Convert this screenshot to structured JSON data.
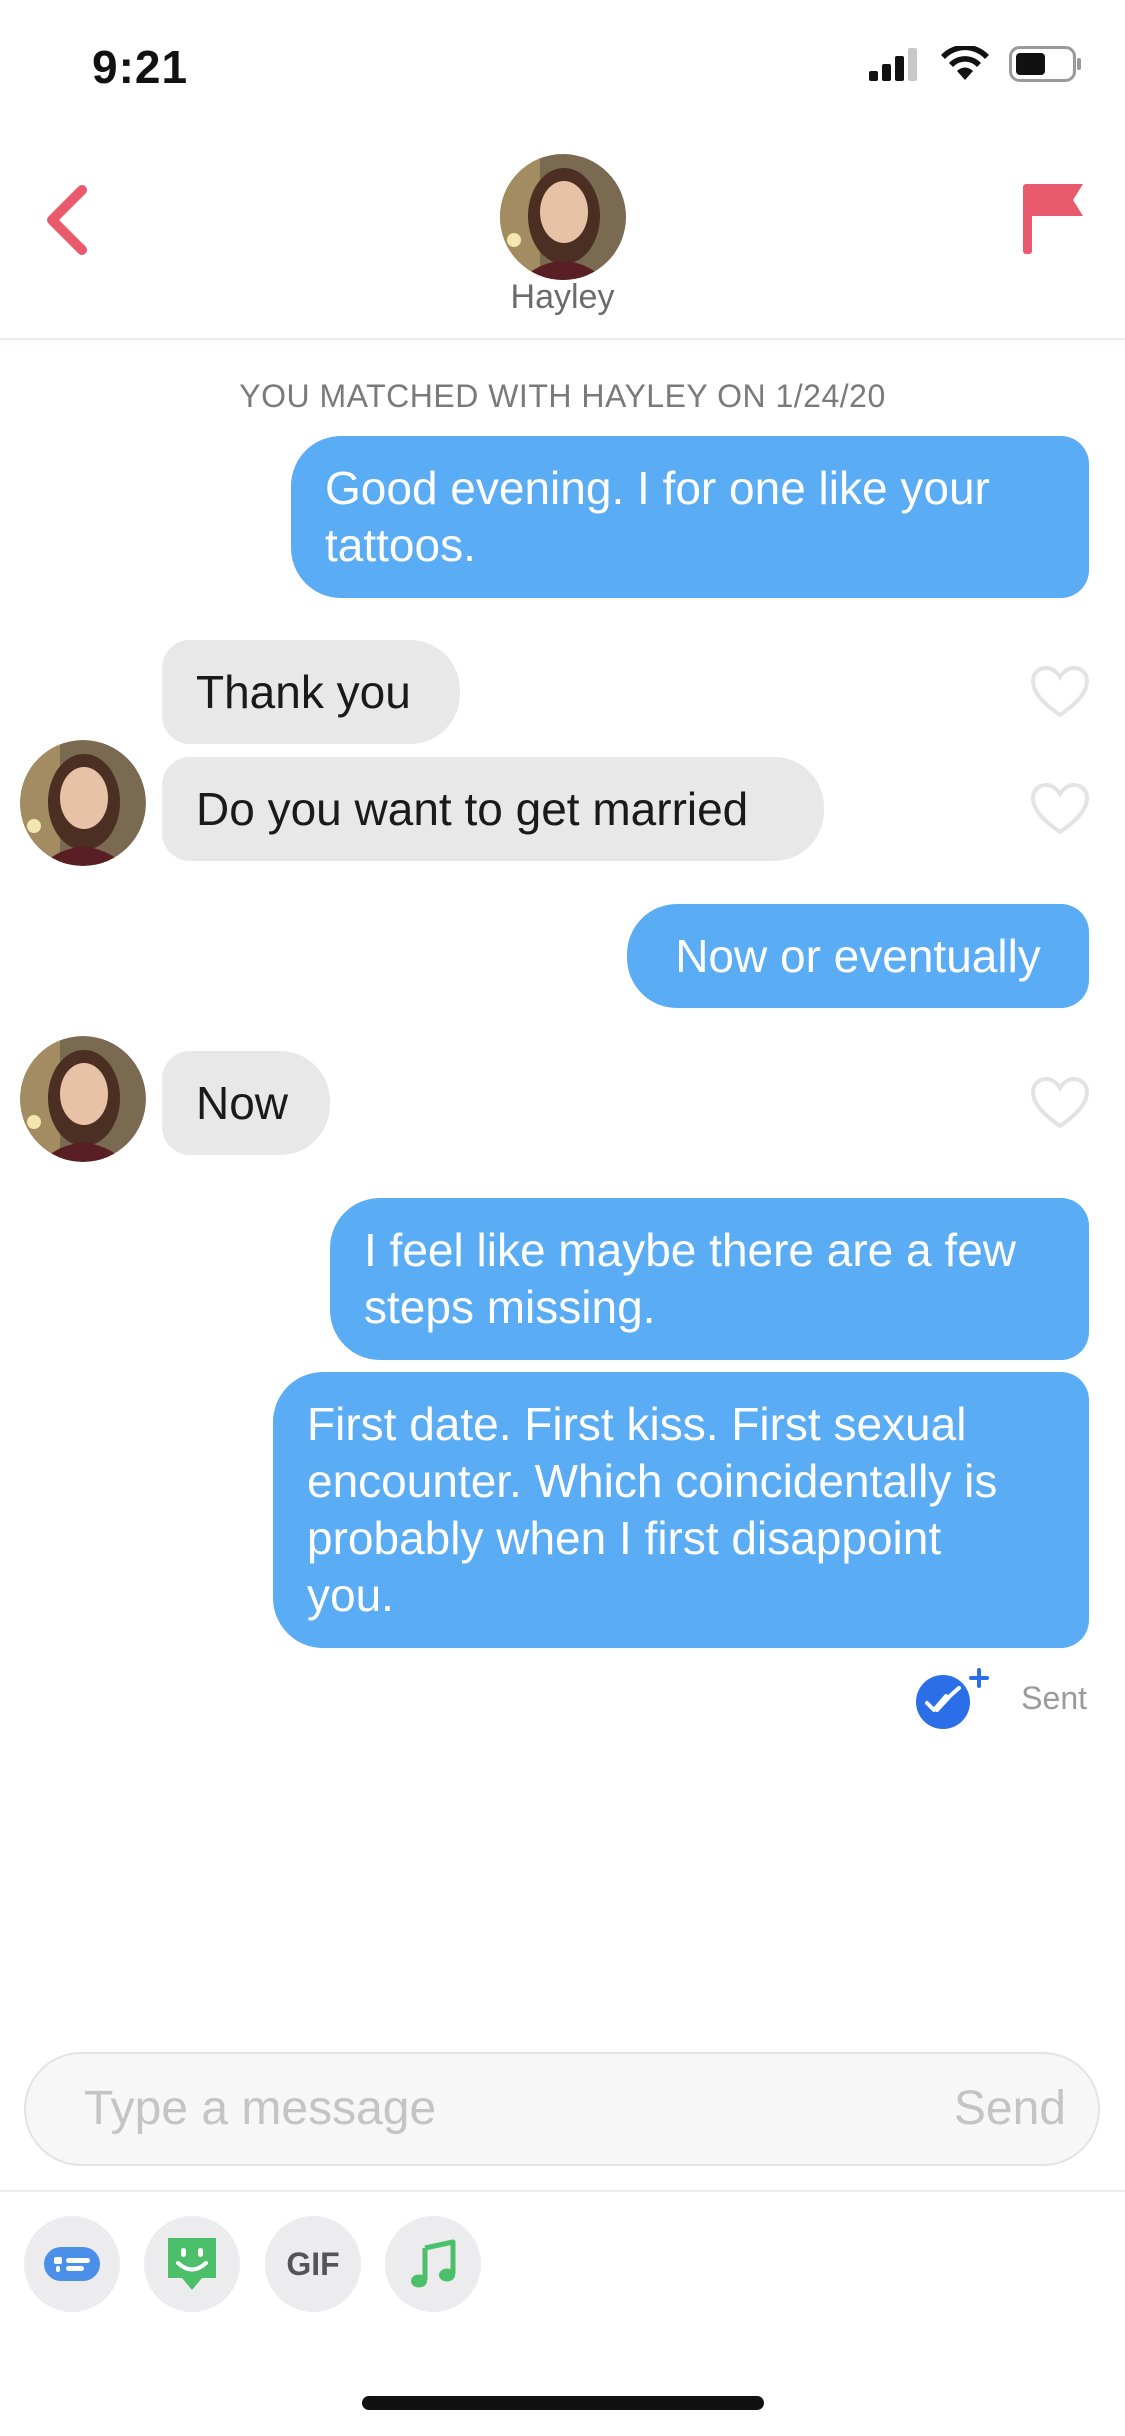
{
  "status_bar": {
    "time": "9:21"
  },
  "header": {
    "name": "Hayley"
  },
  "match_banner": "YOU MATCHED WITH HAYLEY ON 1/24/20",
  "messages": [
    {
      "from": "me",
      "text_lines": [
        "Good evening.   I for one like your",
        "tattoos."
      ]
    },
    {
      "from": "them",
      "text": "Thank you",
      "liked": false
    },
    {
      "from": "them",
      "text": "Do you want to get married",
      "liked": false
    },
    {
      "from": "me",
      "text": "Now or eventually"
    },
    {
      "from": "them",
      "text": "Now",
      "liked": false
    },
    {
      "from": "me",
      "text_lines": [
        "I feel like maybe there are a few",
        "steps missing."
      ]
    },
    {
      "from": "me",
      "text_lines": [
        "First date.  First kiss. First sexual",
        "encounter. Which coincidentally is",
        "probably when I first disappoint",
        "you."
      ]
    }
  ],
  "delivery_status": "Sent",
  "composer": {
    "placeholder": "Type a message",
    "send_label": "Send"
  },
  "toolbar": {
    "gif_label": "GIF"
  },
  "colors": {
    "outgoing_bubble": "#5aacf5",
    "incoming_bubble": "#e8e8e8",
    "accent": "#e85a6c"
  }
}
